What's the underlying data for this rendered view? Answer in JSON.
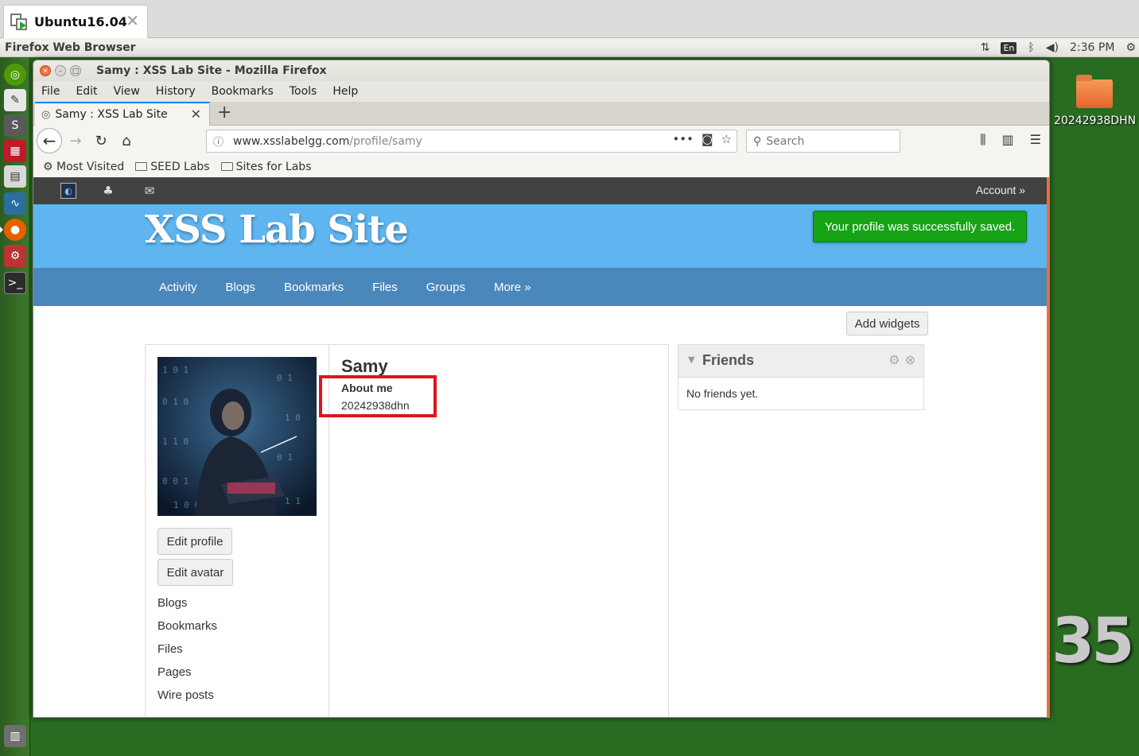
{
  "vm": {
    "tab_title": "Ubuntu16.04",
    "close_glyph": "✕"
  },
  "topbar": {
    "app_name": "Firefox Web Browser",
    "lang": "En",
    "time": "2:36 PM"
  },
  "desktop": {
    "folder_label": "20242938DHN",
    "art_text": "35"
  },
  "firefox": {
    "window_title": "Samy : XSS Lab Site - Mozilla Firefox",
    "menu": [
      "File",
      "Edit",
      "View",
      "History",
      "Bookmarks",
      "Tools",
      "Help"
    ],
    "tab_label": "Samy : XSS Lab Site",
    "url_host": "www.xsslabelgg.com",
    "url_path": "/profile/samy",
    "search_placeholder": "Search",
    "bookmarks": [
      "Most Visited",
      "SEED Labs",
      "Sites for Labs"
    ]
  },
  "site": {
    "account_label": "Account »",
    "title": "XSS Lab Site",
    "success_message": "Your profile was successfully saved.",
    "menu": [
      "Activity",
      "Blogs",
      "Bookmarks",
      "Files",
      "Groups",
      "More »"
    ],
    "add_widgets_label": "Add widgets"
  },
  "profile": {
    "name": "Samy",
    "about_label": "About me",
    "about_value": "20242938dhn",
    "edit_profile_label": "Edit profile",
    "edit_avatar_label": "Edit avatar",
    "links": [
      "Blogs",
      "Bookmarks",
      "Files",
      "Pages",
      "Wire posts"
    ]
  },
  "friends": {
    "title": "Friends",
    "empty_text": "No friends yet."
  },
  "colors": {
    "header_blue": "#5eb5f0",
    "menu_blue": "#4a87bb",
    "success_green": "#16a316",
    "highlight_red": "#e0141e"
  }
}
